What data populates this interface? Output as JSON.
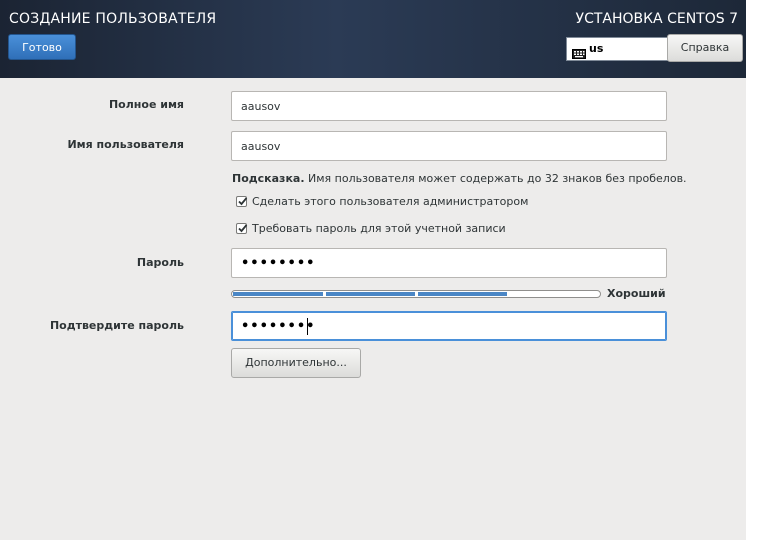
{
  "header": {
    "page_title": "СОЗДАНИЕ ПОЛЬЗОВАТЕЛЯ",
    "done_label": "Готово",
    "product_title": "УСТАНОВКА CENTOS 7",
    "keyboard_layout": "us",
    "keyboard_icon": "keyboard-icon",
    "help_label": "Справка"
  },
  "form": {
    "fullname": {
      "label": "Полное имя",
      "value": "aausov"
    },
    "username": {
      "label": "Имя пользователя",
      "value": "aausov"
    },
    "hint": {
      "bold": "Подсказка.",
      "text": " Имя пользователя может содержать до 32 знаков без пробелов."
    },
    "admin_checkbox": {
      "label": "Сделать этого пользователя администратором",
      "checked": true
    },
    "require_password_checkbox": {
      "label": "Требовать пароль для этой учетной записи",
      "checked": true
    },
    "password": {
      "label": "Пароль",
      "masked_value": "••••••••"
    },
    "strength": {
      "label": "Хороший",
      "level_fraction": 0.75,
      "color": "#4a86c5"
    },
    "confirm": {
      "label": "Подтвердите пароль",
      "masked_value": "••••••••"
    },
    "advanced_label": "Дополнительно..."
  },
  "colors": {
    "header_bg": "#1d2838",
    "accent": "#4a90d9",
    "content_bg": "#edeceb"
  }
}
